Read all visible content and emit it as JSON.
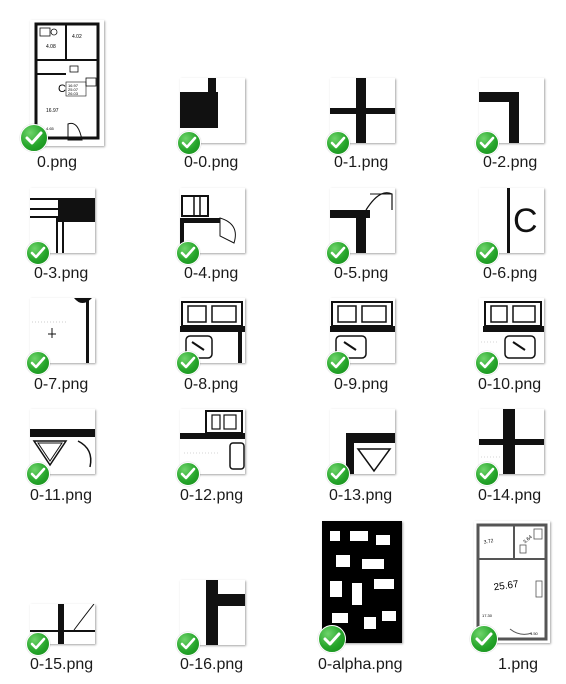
{
  "files": [
    {
      "name": "0.png"
    },
    {
      "name": "0-0.png"
    },
    {
      "name": "0-1.png"
    },
    {
      "name": "0-2.png"
    },
    {
      "name": "0-3.png"
    },
    {
      "name": "0-4.png"
    },
    {
      "name": "0-5.png"
    },
    {
      "name": "0-6.png"
    },
    {
      "name": "0-7.png"
    },
    {
      "name": "0-8.png"
    },
    {
      "name": "0-9.png"
    },
    {
      "name": "0-10.png"
    },
    {
      "name": "0-11.png"
    },
    {
      "name": "0-12.png"
    },
    {
      "name": "0-13.png"
    },
    {
      "name": "0-14.png"
    },
    {
      "name": "0-15.png"
    },
    {
      "name": "0-16.png"
    },
    {
      "name": "0-alpha.png"
    },
    {
      "name": "1.png"
    }
  ],
  "plan0": {
    "r1": "4.02",
    "r2": "4.08",
    "r3": "16.97",
    "c": "C",
    "t1": "16.97",
    "t2": "25.07",
    "t3": "26.03",
    "b": "4.65"
  },
  "plan1": {
    "r1": "3.72",
    "r2": "3.64",
    "main": "25.67",
    "side": "17.30",
    "small": "1.50"
  },
  "tile6": {
    "letter": "C"
  },
  "colors": {
    "check": "#25a52a",
    "ink": "#111111",
    "text": "#1a1a1a"
  }
}
